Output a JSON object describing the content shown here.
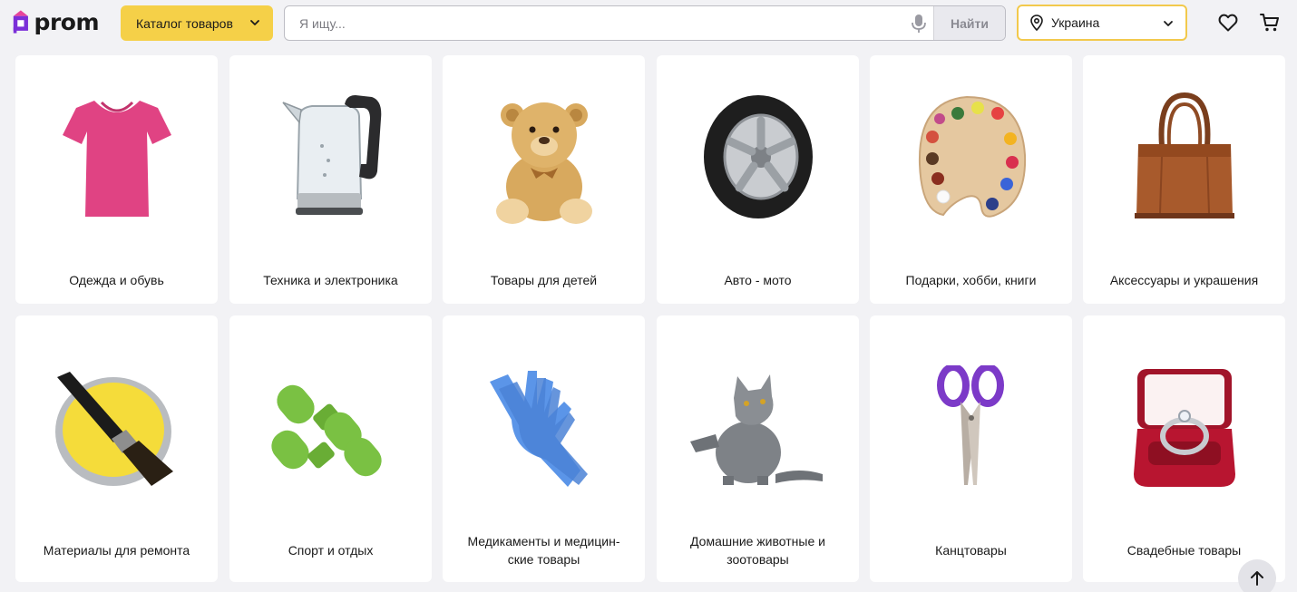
{
  "header": {
    "logo_text": "prom",
    "catalog_label": "Каталог товаров",
    "search_placeholder": "Я ищу...",
    "search_button": "Найти",
    "region": "Украина"
  },
  "colors": {
    "brand_purple": "#7b2fd8",
    "accent_yellow": "#f5d048",
    "region_border": "#f2c94c"
  },
  "categories": [
    {
      "label": "Одежда и обувь",
      "icon": "tshirt-image"
    },
    {
      "label": "Техника и электроника",
      "icon": "kettle-image"
    },
    {
      "label": "Товары для детей",
      "icon": "teddy-bear-image"
    },
    {
      "label": "Авто - мото",
      "icon": "tire-image"
    },
    {
      "label": "Подарки, хобби, книги",
      "icon": "palette-image"
    },
    {
      "label": "Аксессуары и украшения",
      "icon": "handbag-image"
    },
    {
      "label": "Материалы для ремонта",
      "icon": "paint-can-image"
    },
    {
      "label": "Спорт и отдых",
      "icon": "dumbbells-image"
    },
    {
      "label": "Медикаменты и медицин-\nские товары",
      "icon": "gloves-image"
    },
    {
      "label": "Домашние животные и\nзоотовары",
      "icon": "cat-image"
    },
    {
      "label": "Канцтовары",
      "icon": "scissors-image"
    },
    {
      "label": "Свадебные товары",
      "icon": "ring-box-image"
    }
  ]
}
